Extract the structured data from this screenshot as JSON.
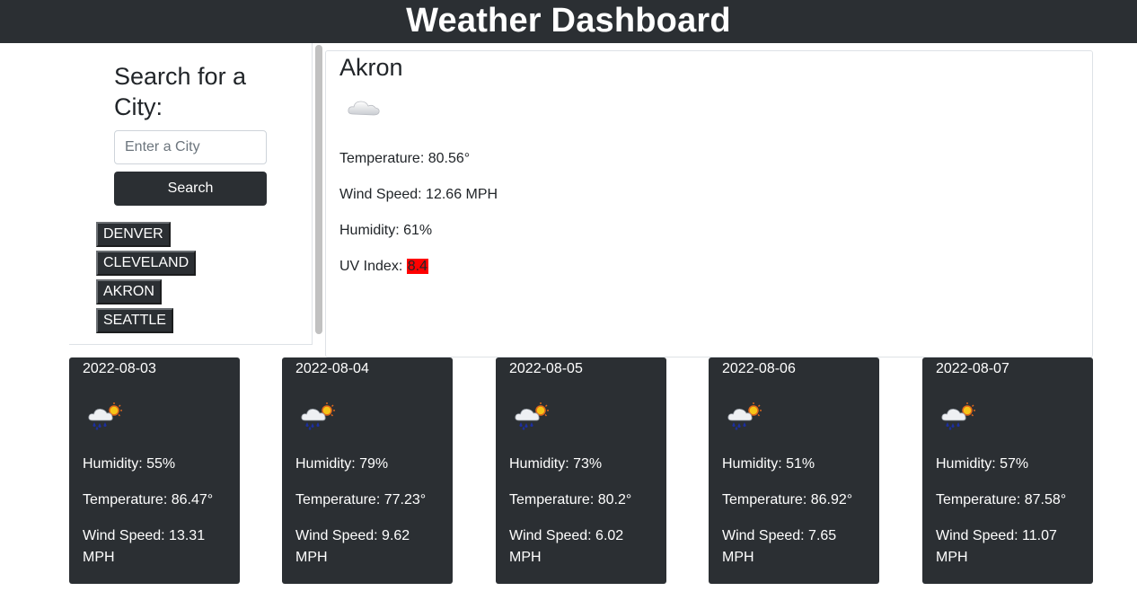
{
  "header": {
    "title": "Weather Dashboard"
  },
  "sidebar": {
    "heading": "Search for a City:",
    "input": {
      "placeholder": "Enter a City",
      "value": ""
    },
    "search_label": "Search",
    "history": [
      "DENVER",
      "CLEVELAND",
      "AKRON",
      "SEATTLE"
    ]
  },
  "current": {
    "city": "Akron",
    "icon": "cloud-icon",
    "temperature": "Temperature: 80.56°",
    "wind": "Wind Speed: 12.66 MPH",
    "humidity": "Humidity: 61%",
    "uv_label": "UV Index: ",
    "uv_value": "8.4",
    "uv_color": "#ff0000"
  },
  "forecast": [
    {
      "date": "2022-08-03",
      "icon": "rain-sun-icon",
      "humidity": "Humidity: 55%",
      "temperature": "Temperature: 86.47°",
      "wind": "Wind Speed: 13.31 MPH"
    },
    {
      "date": "2022-08-04",
      "icon": "rain-sun-icon",
      "humidity": "Humidity: 79%",
      "temperature": "Temperature: 77.23°",
      "wind": "Wind Speed: 9.62 MPH"
    },
    {
      "date": "2022-08-05",
      "icon": "rain-sun-icon",
      "humidity": "Humidity: 73%",
      "temperature": "Temperature: 80.2°",
      "wind": "Wind Speed: 6.02 MPH"
    },
    {
      "date": "2022-08-06",
      "icon": "rain-sun-icon",
      "humidity": "Humidity: 51%",
      "temperature": "Temperature: 86.92°",
      "wind": "Wind Speed: 7.65 MPH"
    },
    {
      "date": "2022-08-07",
      "icon": "rain-sun-icon",
      "humidity": "Humidity: 57%",
      "temperature": "Temperature: 87.58°",
      "wind": "Wind Speed: 11.07 MPH"
    }
  ],
  "colors": {
    "dark": "#2b2f33",
    "uv_high": "#ff0000"
  }
}
